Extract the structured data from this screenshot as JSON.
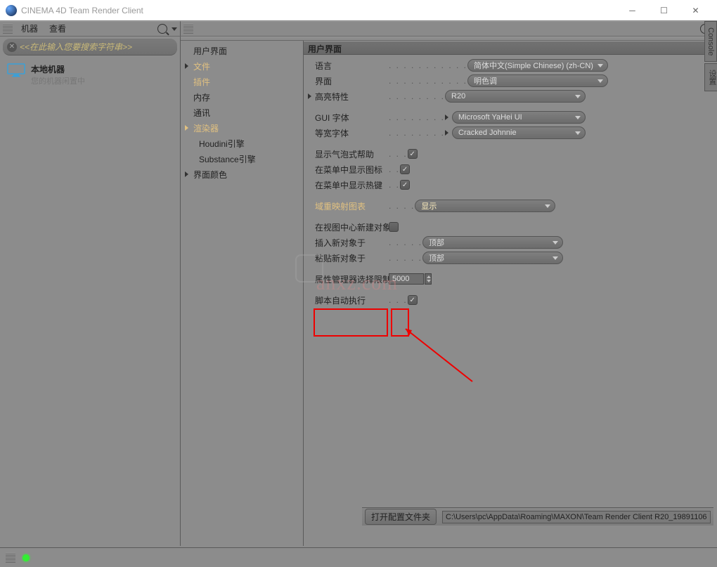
{
  "window": {
    "title": "CINEMA 4D Team Render Client"
  },
  "menubar": {
    "m1": "机器",
    "m2": "查看"
  },
  "search": {
    "placeholder": "<<在此输入您要搜索字符串>>"
  },
  "machine": {
    "name": "本地机器",
    "status": "您的机器闲置中"
  },
  "tree": {
    "n0": "用户界面",
    "n1": "文件",
    "n2": "插件",
    "n3": "内存",
    "n4": "通讯",
    "n5": "渲染器",
    "n6": "Houdini引擎",
    "n7": "Substance引擎",
    "n8": "界面颜色"
  },
  "panel": {
    "header": "用户界面"
  },
  "labels": {
    "lang": "语言",
    "iface": "界面",
    "highlight": "高亮特性",
    "guifont": "GUI 字体",
    "monofont": "等宽字体",
    "bubble": "显示气泡式帮助",
    "menuicon": "在菜单中显示图标",
    "menuhot": "在菜单中显示热键",
    "fieldmap": "域重映射图表",
    "newcenter": "在视图中心新建对象",
    "insertat": "插入新对象于",
    "pasteat": "粘贴新对象于",
    "attrlimit": "属性管理器选择限制",
    "scriptauto": "脚本自动执行"
  },
  "values": {
    "lang": "简体中文(Simple Chinese) (zh-CN)",
    "iface": "明色调",
    "highlight": "R20",
    "guifont": "Microsoft YaHei UI",
    "monofont": "Cracked Johnnie",
    "fieldmap": "显示",
    "insertat": "顶部",
    "pasteat": "顶部",
    "attrlimit": "5000"
  },
  "checks": {
    "bubble": true,
    "menuicon": true,
    "menuhot": true,
    "newcenter": false,
    "scriptauto": true
  },
  "footer": {
    "btn": "打开配置文件夹",
    "path": "C:\\Users\\pc\\AppData\\Roaming\\MAXON\\Team Render Client R20_19891106"
  },
  "sidetabs": {
    "t1": "Console",
    "t2": "设置"
  },
  "watermark": "anxz.com"
}
